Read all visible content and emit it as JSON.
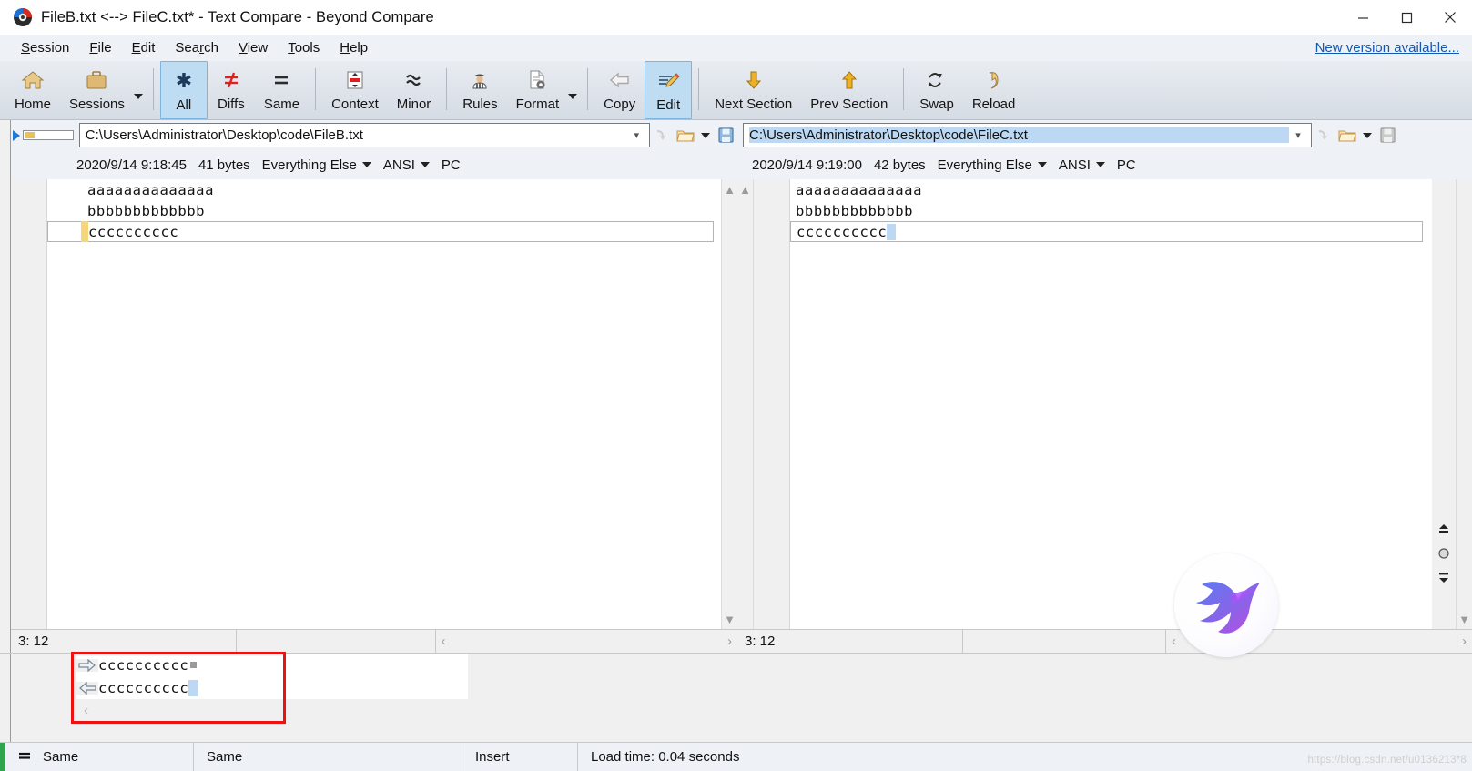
{
  "window": {
    "title": "FileB.txt <--> FileC.txt* - Text Compare - Beyond Compare",
    "app_icon": "beyond-compare-logo-icon",
    "minimize_label": "—",
    "maximize_label": "□",
    "close_label": "✕"
  },
  "menu": {
    "items": [
      {
        "pre": "",
        "accel": "S",
        "post": "ession"
      },
      {
        "pre": "",
        "accel": "F",
        "post": "ile"
      },
      {
        "pre": "",
        "accel": "E",
        "post": "dit"
      },
      {
        "pre": "Sea",
        "accel": "r",
        "post": "ch"
      },
      {
        "pre": "",
        "accel": "V",
        "post": "iew"
      },
      {
        "pre": "",
        "accel": "T",
        "post": "ools"
      },
      {
        "pre": "",
        "accel": "H",
        "post": "elp"
      }
    ],
    "new_version": "New version available..."
  },
  "toolbar": {
    "buttons": [
      {
        "label": "Home",
        "icon": "home-icon",
        "active": false
      },
      {
        "label": "Sessions",
        "icon": "briefcase-icon",
        "active": false,
        "has_caret": true
      },
      {
        "label": "All",
        "icon": "asterisk-icon",
        "active": true
      },
      {
        "label": "Diffs",
        "icon": "not-equals-icon",
        "active": false
      },
      {
        "label": "Same",
        "icon": "equals-icon",
        "active": false
      },
      {
        "label": "Context",
        "icon": "context-lines-icon",
        "active": false
      },
      {
        "label": "Minor",
        "icon": "approx-equals-icon",
        "active": false
      },
      {
        "label": "Rules",
        "icon": "referee-icon",
        "active": false
      },
      {
        "label": "Format",
        "icon": "document-gear-icon",
        "active": false,
        "has_caret": true
      },
      {
        "label": "Copy",
        "icon": "arrow-left-copy-icon",
        "active": false
      },
      {
        "label": "Edit",
        "icon": "pencil-edit-icon",
        "active": true
      },
      {
        "label": "Next Section",
        "icon": "arrow-down-icon",
        "active": false
      },
      {
        "label": "Prev Section",
        "icon": "arrow-up-icon",
        "active": false
      },
      {
        "label": "Swap",
        "icon": "swap-arrows-icon",
        "active": false
      },
      {
        "label": "Reload",
        "icon": "reload-icon",
        "active": false
      }
    ]
  },
  "left_pane": {
    "path": "C:\\Users\\Administrator\\Desktop\\code\\FileB.txt",
    "path_selected": false,
    "dropdown_icon": "chevron-down-icon",
    "browse_icon": "open-folder-icon",
    "save_icon": "save-disk-icon",
    "info": {
      "timestamp": "2020/9/14 9:18:45",
      "size": "41 bytes",
      "ruleset": "Everything Else",
      "encoding": "ANSI",
      "line_ending": "PC"
    },
    "lines": [
      {
        "text": "aaaaaaaaaaaaaa",
        "changed": false,
        "current": false
      },
      {
        "text": "bbbbbbbbbbbbb",
        "changed": false,
        "current": false
      },
      {
        "text": "cccccccccc",
        "changed": true,
        "current": true
      }
    ],
    "cursor_position": "3: 12"
  },
  "right_pane": {
    "path": "C:\\Users\\Administrator\\Desktop\\code\\FileC.txt",
    "path_selected": true,
    "dropdown_icon": "chevron-down-icon",
    "browse_icon": "open-folder-icon",
    "save_icon": "save-disk-icon",
    "info": {
      "timestamp": "2020/9/14 9:19:00",
      "size": "42 bytes",
      "ruleset": "Everything Else",
      "encoding": "ANSI",
      "line_ending": "PC"
    },
    "lines": [
      {
        "text": "aaaaaaaaaaaaaa",
        "changed": false,
        "current": false
      },
      {
        "text": "bbbbbbbbbbbbb",
        "changed": false,
        "current": false
      },
      {
        "text": "cccccccccc",
        "changed": false,
        "current": true,
        "trailing_highlight": true
      }
    ],
    "cursor_position": "3: 12"
  },
  "diff_detail": {
    "rows": [
      {
        "direction_icon": "arrow-right-icon",
        "text": "cccccccccc",
        "marker": "grey"
      },
      {
        "direction_icon": "arrow-left-icon",
        "text": "cccccccccc",
        "marker": "blue"
      }
    ],
    "scroll_left_icon": "chevron-left-icon"
  },
  "nav_column": {
    "buttons": [
      {
        "icon": "scroll-to-top-icon"
      },
      {
        "icon": "center-dot-icon"
      },
      {
        "icon": "scroll-to-bottom-icon"
      }
    ]
  },
  "status_bar": {
    "compare_icon": "equals-icon",
    "left_state": "Same",
    "right_state": "Same",
    "edit_mode": "Insert",
    "load_time": "Load time: 0.04 seconds"
  },
  "watermark": {
    "icon": "hummingbird-logo-icon",
    "credit": "https://blog.csdn.net/u0136213*8"
  },
  "colors": {
    "accent_blue": "#bedcf2",
    "selection_blue": "#bcd8f2",
    "change_yellow": "#f5d77a",
    "annotation_red": "#ee1111",
    "link_blue": "#1558b0"
  }
}
